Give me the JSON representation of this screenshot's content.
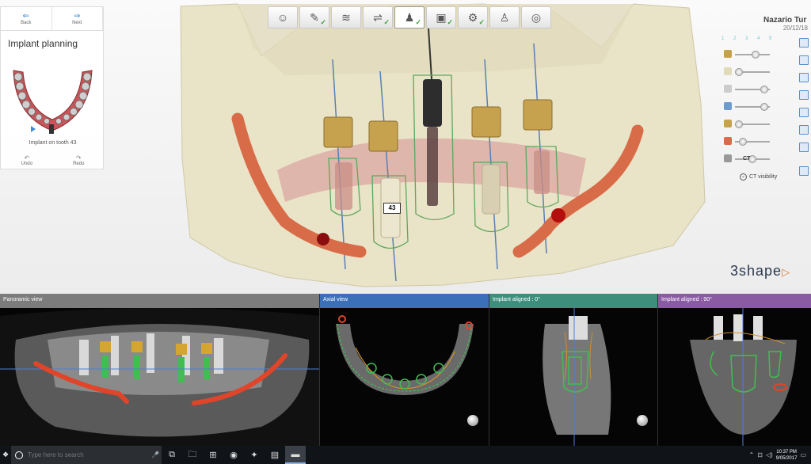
{
  "navigation": {
    "back_label": "Back",
    "next_label": "Next"
  },
  "panel": {
    "title": "Implant planning",
    "caption": "Implant on tooth 43",
    "undo_label": "Undo",
    "redo_label": "Redo"
  },
  "workflow_steps": [
    {
      "icon": "patient-photo-icon",
      "glyph": "☺",
      "done": false
    },
    {
      "icon": "order-form-icon",
      "glyph": "✎",
      "done": true
    },
    {
      "icon": "scan-icon",
      "glyph": "≋",
      "done": false
    },
    {
      "icon": "align-icon",
      "glyph": "⇌",
      "done": true
    },
    {
      "icon": "implant-icon",
      "glyph": "♟",
      "done": true,
      "active": true
    },
    {
      "icon": "guide-icon",
      "glyph": "▣",
      "done": true
    },
    {
      "icon": "export-icon",
      "glyph": "⚙",
      "done": true
    },
    {
      "icon": "people-icon",
      "glyph": "♙",
      "done": false
    },
    {
      "icon": "globe-icon",
      "glyph": "◎",
      "done": false
    }
  ],
  "user": {
    "name": "Nazario Tur",
    "date": "20/12/18"
  },
  "step_indicator": "1 2 3 4 5",
  "layers": [
    {
      "icon": "sleeve-icon",
      "value": 0.62
    },
    {
      "icon": "model-icon",
      "value": 0.0
    },
    {
      "icon": "guide-layer-icon",
      "value": 0.95
    },
    {
      "icon": "implant-layer-icon",
      "value": 0.95
    },
    {
      "icon": "abutment-icon",
      "value": 0.0
    },
    {
      "icon": "nerve-icon",
      "value": 0.15
    },
    {
      "icon": "ct-icon",
      "value": 0.5
    }
  ],
  "ct_label": "CT",
  "ct_visibility_label": "CT visibility",
  "implant_label": "43",
  "brand": "3shape",
  "ct_views": [
    {
      "title": "Panoramic view",
      "color": "#7c7c7c"
    },
    {
      "title": "Axial view",
      "color": "#3b6fb8"
    },
    {
      "title": "Implant aligned : 0°",
      "color": "#3d8f7c"
    },
    {
      "title": "Implant aligned : 90°",
      "color": "#8a5aa3"
    }
  ],
  "taskbar": {
    "search_placeholder": "Type here to search",
    "apps": [
      "task-view-icon",
      "file-explorer-icon",
      "store-icon",
      "chrome-icon",
      "app-icon",
      "media-icon",
      "active-app-icon"
    ],
    "time": "10:37 PM",
    "date": "9/05/2017"
  },
  "colors": {
    "accent": "#3c8fd4",
    "bone": "#e8e2c4",
    "nerve": "#e0673f",
    "guide": "#3aa53a"
  }
}
